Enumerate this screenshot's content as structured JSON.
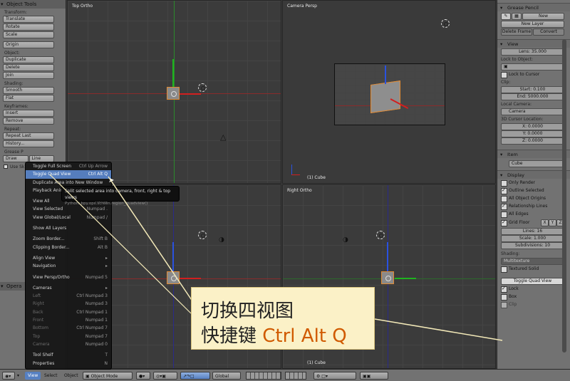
{
  "tool_shelf": {
    "header": "Object Tools",
    "sections": [
      {
        "label": "Transform:",
        "buttons": [
          "Translate",
          "Rotate",
          "Scale"
        ]
      },
      {
        "label": "",
        "buttons": [
          "Origin"
        ]
      },
      {
        "label": "Object:",
        "buttons": [
          "Duplicate",
          "Delete",
          "Join"
        ]
      },
      {
        "label": "Shading:",
        "buttons": [
          "Smooth",
          "Flat"
        ]
      },
      {
        "label": "Keyframes:",
        "buttons": [
          "Insert",
          "Remove"
        ]
      },
      {
        "label": "Repeat:",
        "buttons": [
          "Repeat Last",
          "History..."
        ]
      }
    ],
    "grease_label": "Grease P",
    "grease_buttons": [
      "Draw",
      "Line"
    ],
    "use_sketching": "Use Sk",
    "operator_header": "Opera"
  },
  "viewports": {
    "top_left": {
      "title": "Top Ortho"
    },
    "top_right": {
      "title": "Camera Persp",
      "footer": "(1) Cube"
    },
    "bottom_left": {
      "title": ""
    },
    "bottom_right": {
      "title": "Right Ortho",
      "footer": "(1) Cube"
    }
  },
  "view_menu": {
    "items": [
      {
        "label": "Toggle Full Screen",
        "shortcut": "Ctrl Up Arrow"
      },
      {
        "label": "Toggle Quad View",
        "shortcut": "Ctrl Alt Q",
        "highlight": true
      },
      {
        "label": "Duplicate Area into New Window",
        "shortcut": ""
      },
      {
        "label": "Playback Animation",
        "shortcut": ""
      },
      {
        "sep": true
      },
      {
        "label": "View All",
        "shortcut": "Home"
      },
      {
        "label": "View Selected",
        "shortcut": "Numpad ."
      },
      {
        "label": "View Global/Local",
        "shortcut": "Numpad /"
      },
      {
        "sep": true
      },
      {
        "label": "Show All Layers",
        "shortcut": ""
      },
      {
        "sep": true
      },
      {
        "label": "Zoom Border...",
        "shortcut": "Shift B"
      },
      {
        "label": "Clipping Border...",
        "shortcut": "Alt B"
      },
      {
        "sep": true
      },
      {
        "label": "Align View",
        "shortcut": "▸"
      },
      {
        "label": "Navigation",
        "shortcut": "▸"
      },
      {
        "sep": true
      },
      {
        "label": "View Persp/Ortho",
        "shortcut": "Numpad 5"
      },
      {
        "sep": true
      },
      {
        "label": "Cameras",
        "shortcut": "▸"
      },
      {
        "label": "Left",
        "shortcut": "Ctrl Numpad 3",
        "dim": true
      },
      {
        "label": "Right",
        "shortcut": "Numpad 3",
        "dim": true
      },
      {
        "label": "Back",
        "shortcut": "Ctrl Numpad 1",
        "dim": true
      },
      {
        "label": "Front",
        "shortcut": "Numpad 1",
        "dim": true
      },
      {
        "label": "Bottom",
        "shortcut": "Ctrl Numpad 7",
        "dim": true
      },
      {
        "label": "Top",
        "shortcut": "Numpad 7",
        "dim": true
      },
      {
        "label": "Camera",
        "shortcut": "Numpad 0",
        "dim": true
      },
      {
        "sep": true
      },
      {
        "label": "Tool Shelf",
        "shortcut": "T"
      },
      {
        "label": "Properties",
        "shortcut": "N"
      }
    ]
  },
  "tooltip": {
    "line1": "Split selected area into camera, front, right & top views",
    "line2": "Python: bpy.ops.screen.region_quadview()"
  },
  "properties": {
    "grease_pencil": {
      "header": "Grease Pencil",
      "new": "New",
      "new_layer": "New Layer",
      "delete_frame": "Delete Frame",
      "convert": "Convert"
    },
    "view": {
      "header": "View",
      "lens": "Lens: 35.000",
      "lock_to_object": "Lock to Object:",
      "lock_to_cursor": "Lock to Cursor",
      "clip": "Clip:",
      "clip_start": "Start: 0.100",
      "clip_end": "End: 5000.000",
      "local_camera": "Local Camera:",
      "camera": "Camera",
      "cursor_location": "3D Cursor Location:",
      "cx": "X: 0.0000",
      "cy": "Y: 0.0000",
      "cz": "Z: 0.0000"
    },
    "item": {
      "header": "Item",
      "name": "Cube"
    },
    "display": {
      "header": "Display",
      "only_render": "Only Render",
      "outline_selected": "Outline Selected",
      "all_object_origins": "All Object Origins",
      "relationship_lines": "Relationship Lines",
      "all_edges": "All Edges",
      "grid_floor": "Grid Floor",
      "axis_x": "X",
      "axis_y": "Y",
      "axis_z": "Z",
      "lines": "Lines: 16",
      "scale": "Scale: 1.000",
      "subdivisions": "Subdivisions: 10"
    },
    "shading": {
      "label": "Shading:",
      "mode": "Multitexture",
      "textured_solid": "Textured Solid"
    },
    "toggle_quad_view": "Toggle Quad View",
    "lock": "Lock",
    "box": "Box",
    "clip": "Clip"
  },
  "bottom_bar": {
    "view": "View",
    "select": "Select",
    "object": "Object",
    "mode": "Object Mode",
    "orientation": "Global"
  },
  "callout": {
    "line1": "切换四视图",
    "line2_prefix": "快捷键 ",
    "line2_keys": "Ctrl Alt Q"
  },
  "colors": {
    "highlight": "#5680c2",
    "x_axis": "#d21f1f",
    "y_axis": "#1fb31f",
    "z_axis": "#2a52e0",
    "selection": "#e08a34",
    "callout_bg": "#fbf1c7"
  }
}
